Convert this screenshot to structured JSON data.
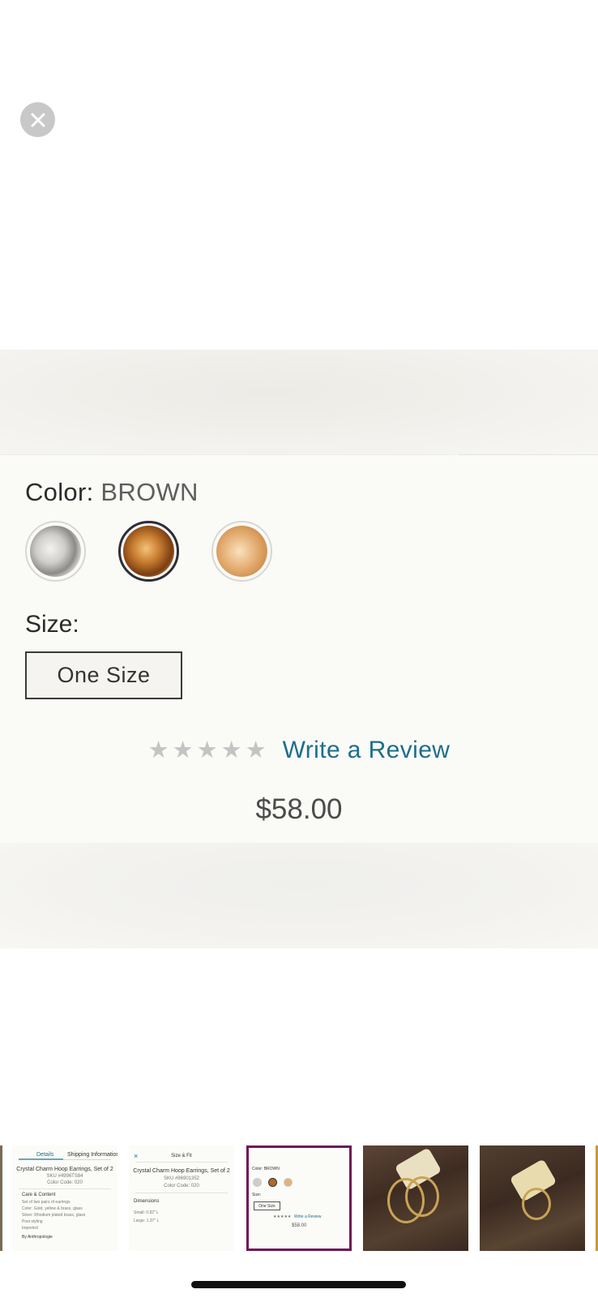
{
  "close_button": {
    "icon": "close-icon"
  },
  "product": {
    "color_label": "Color:",
    "color_value": "BROWN",
    "swatches": [
      {
        "name": "silver",
        "selected": false
      },
      {
        "name": "brown",
        "selected": true
      },
      {
        "name": "gold",
        "selected": false
      }
    ],
    "size_label": "Size:",
    "size_option": "One Size",
    "rating_stars": 5,
    "rating_value": 0,
    "review_link": "Write a Review",
    "price": "$58.00"
  },
  "thumbnails": {
    "selected_index": 2,
    "details": {
      "tab_details": "Details",
      "tab_shipping": "Shipping Information",
      "title": "Crystal Charm Hoop Earrings, Set of 2",
      "sku": "SKU #4996TS84",
      "color_code": "Color Code: 020",
      "care_heading": "Care & Content",
      "care_lines": [
        "Set of two pairs of earrings",
        "Color: Gold, yellow & brass, glass",
        "Silver: Rhodium plated brass, glass",
        "Post styling",
        "Imported"
      ],
      "brand": "By Anthropologie"
    },
    "size_fit": {
      "heading": "Size & Fit",
      "title": "Crystal Charm Hoop Earrings, Set of 2",
      "sku": "SKU #96901352",
      "color_code": "Color Code: 020",
      "dimensions_heading": "Dimensions",
      "dim_small": "Small: 0.82\" L",
      "dim_large": "Large: 1.37\" L"
    },
    "current": {
      "color_label": "Color: BROWN",
      "size_label": "Size:",
      "size_option": "One Size",
      "review_link": "Write a Review",
      "price": "$58.00"
    }
  }
}
